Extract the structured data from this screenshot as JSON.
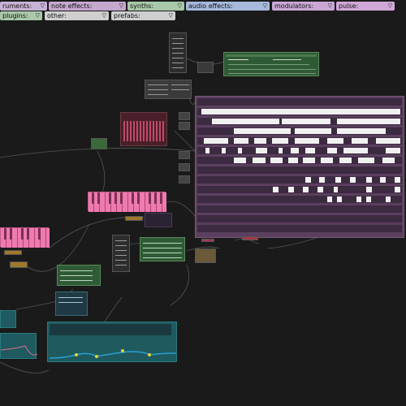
{
  "menu": {
    "row1": [
      {
        "label": "ruments:",
        "color": "#c8b2d6"
      },
      {
        "label": "note effects:",
        "color": "#c6a8cf"
      },
      {
        "label": "synths:",
        "color": "#a9c8a9"
      },
      {
        "label": "audio effects:",
        "color": "#a6b8dc"
      },
      {
        "label": "modulators:",
        "color": "#c9a8d6"
      },
      {
        "label": "pulse:",
        "color": "#d0a8d8"
      }
    ],
    "row2": [
      {
        "label": "plugins:",
        "color": "#a9c8a9"
      },
      {
        "label": "other:",
        "color": "#cfcfcf"
      },
      {
        "label": "prefabs:",
        "color": "#cfcfcf"
      }
    ],
    "arrow_glyph": "▽"
  },
  "colors": {
    "background": "#1a1a1a",
    "sequencer": "#5b3f5f",
    "sequencer_note": "#f1f1f1",
    "keyboard": "#ee7ab0",
    "synth_green": "#3a6a3a",
    "teal": "#1e5a5f",
    "curve": "#2aa0d0",
    "curve_point": "#e6d23a"
  }
}
